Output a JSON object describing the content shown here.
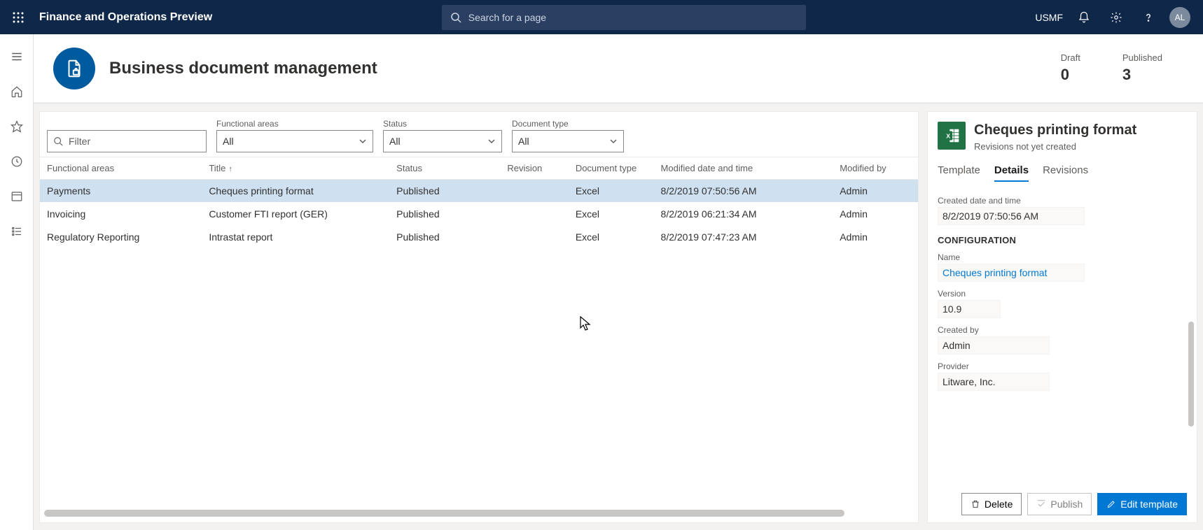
{
  "topbar": {
    "title": "Finance and Operations Preview",
    "search_placeholder": "Search for a page",
    "company": "USMF",
    "avatar": "AL"
  },
  "workspace": {
    "title": "Business document management",
    "stats": {
      "draft_label": "Draft",
      "draft_value": "0",
      "published_label": "Published",
      "published_value": "3"
    }
  },
  "filters": {
    "filter_placeholder": "Filter",
    "functional_areas_label": "Functional areas",
    "functional_areas_value": "All",
    "status_label": "Status",
    "status_value": "All",
    "document_type_label": "Document type",
    "document_type_value": "All"
  },
  "columns": {
    "functional_areas": "Functional areas",
    "title": "Title",
    "status": "Status",
    "revision": "Revision",
    "document_type": "Document type",
    "modified": "Modified date and time",
    "modified_by": "Modified by"
  },
  "rows": [
    {
      "fa": "Payments",
      "title": "Cheques printing format",
      "status": "Published",
      "revision": "",
      "dtype": "Excel",
      "modified": "8/2/2019 07:50:56 AM",
      "modified_by": "Admin"
    },
    {
      "fa": "Invoicing",
      "title": "Customer FTI report (GER)",
      "status": "Published",
      "revision": "",
      "dtype": "Excel",
      "modified": "8/2/2019 06:21:34 AM",
      "modified_by": "Admin"
    },
    {
      "fa": "Regulatory Reporting",
      "title": "Intrastat report",
      "status": "Published",
      "revision": "",
      "dtype": "Excel",
      "modified": "8/2/2019 07:47:23 AM",
      "modified_by": "Admin"
    }
  ],
  "details": {
    "title": "Cheques printing format",
    "subtitle": "Revisions not yet created",
    "tabs": {
      "template": "Template",
      "details": "Details",
      "revisions": "Revisions"
    },
    "created_label": "Created date and time",
    "created_value": "8/2/2019 07:50:56 AM",
    "config_heading": "CONFIGURATION",
    "name_label": "Name",
    "name_value": "Cheques printing format",
    "version_label": "Version",
    "version_value": "10.9",
    "created_by_label": "Created by",
    "created_by_value": "Admin",
    "provider_label": "Provider",
    "provider_value": "Litware, Inc.",
    "actions": {
      "delete": "Delete",
      "publish": "Publish",
      "edit": "Edit template"
    }
  }
}
